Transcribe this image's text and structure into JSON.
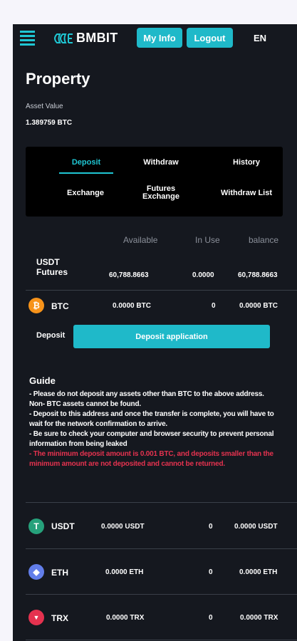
{
  "header": {
    "logo_text": "BMBIT",
    "my_info": "My Info",
    "logout": "Logout",
    "lang": "EN"
  },
  "page": {
    "title": "Property",
    "asset_label": "Asset Value",
    "asset_value": "1.389759 BTC"
  },
  "tabs": {
    "deposit": "Deposit",
    "withdraw": "Withdraw",
    "history": "History",
    "exchange": "Exchange",
    "futures_exchange_1": "Futures",
    "futures_exchange_2": "Exchange",
    "withdraw_list": "Withdraw List",
    "active": "Deposit"
  },
  "table": {
    "headers": [
      "Available",
      "In Use",
      "balance"
    ]
  },
  "usdt_futures": {
    "label_1": "USDT",
    "label_2": "Futures",
    "available": "60,788.8663",
    "in_use": "0.0000",
    "balance": "60,788.8663"
  },
  "coins": [
    {
      "name": "BTC",
      "icon": "bitcoin-icon",
      "color": "#f7931a",
      "glyph": "₿",
      "available": "0.0000 BTC",
      "in_use": "0",
      "balance": "0.0000 BTC"
    },
    {
      "name": "USDT",
      "icon": "tether-icon",
      "color": "#26a17b",
      "glyph": "T",
      "available": "0.0000 USDT",
      "in_use": "0",
      "balance": "0.0000 USDT"
    },
    {
      "name": "ETH",
      "icon": "ethereum-icon",
      "color": "#627eea",
      "glyph": "◆",
      "available": "0.0000 ETH",
      "in_use": "0",
      "balance": "0.0000 ETH"
    },
    {
      "name": "TRX",
      "icon": "tron-icon",
      "color": "#e5324f",
      "glyph": "▼",
      "available": "0.0000 TRX",
      "in_use": "0",
      "balance": "0.0000 TRX"
    }
  ],
  "deposit": {
    "label": "Deposit",
    "button": "Deposit application"
  },
  "guide": {
    "title": "Guide",
    "lines": [
      "- Please do not deposit any assets other than BTC to the above address. Non- BTC assets cannot be found.",
      "- Deposit to this address and once the transfer is complete, you will have to wait for the network confirmation to arrive.",
      "- Be sure to check your computer and browser security to prevent personal information from being leaked"
    ],
    "warning": "- The minimum deposit amount is 0.001 BTC, and deposits smaller than the minimum amount are not deposited and cannot be returned."
  },
  "colors": {
    "accent": "#1fb9c9",
    "background": "#15181f",
    "warning": "#e5324f"
  }
}
